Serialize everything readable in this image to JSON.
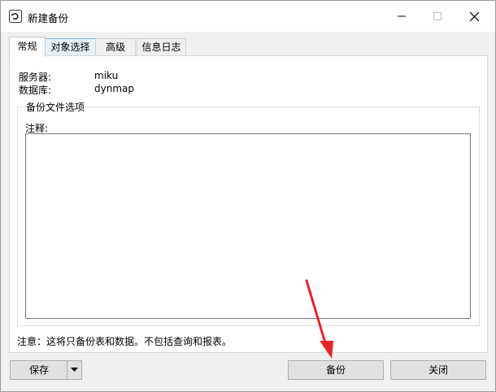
{
  "window": {
    "title": "新建备份"
  },
  "tabs": [
    {
      "label": "常规"
    },
    {
      "label": "对象选择"
    },
    {
      "label": "高级"
    },
    {
      "label": "信息日志"
    }
  ],
  "general": {
    "server_label": "服务器:",
    "server_value": "miku",
    "database_label": "数据库:",
    "database_value": "dynmap",
    "group_title": "备份文件选项",
    "comment_label": "注释:",
    "comment_value": "",
    "note": "注意：这将只备份表和数据。不包括查询和报表。"
  },
  "footer": {
    "save_label": "保存",
    "backup_label": "备份",
    "close_label": "关闭"
  },
  "colors": {
    "annotation_arrow": "#e8262a",
    "tab_highlight": "#e5f1fb"
  }
}
